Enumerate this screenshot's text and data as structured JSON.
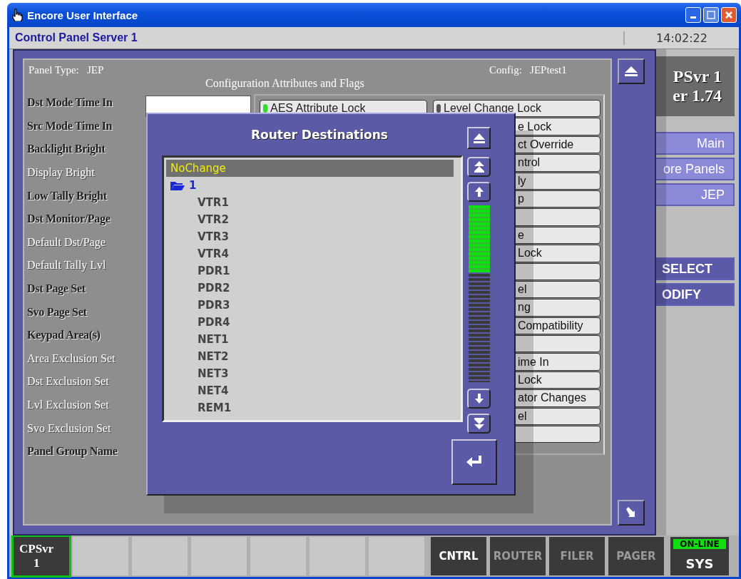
{
  "window": {
    "title": "Encore User Interface"
  },
  "header": {
    "title": "Control Panel Server 1",
    "clock": "14:02:22"
  },
  "logo": {
    "name": "PSvr 1",
    "version": "er 1.74"
  },
  "nav_buttons": [
    {
      "label": "Main"
    },
    {
      "label": "ore Panels"
    },
    {
      "label": "JEP"
    }
  ],
  "action_buttons": [
    {
      "label": "SELECT"
    },
    {
      "label": "ODIFY"
    }
  ],
  "config_dialog": {
    "panel_type_label": "Panel Type:",
    "panel_type": "JEP",
    "title": "Configuration Attributes and Flags",
    "config_label": "Config:",
    "config": "JEPtest1",
    "fields": [
      {
        "label": "Dst Mode Time In",
        "kind": "embossed"
      },
      {
        "label": "Src Mode Time In",
        "kind": "embossed"
      },
      {
        "label": "Backlight Bright",
        "kind": "embossed"
      },
      {
        "label": "Display Bright",
        "kind": "plain"
      },
      {
        "label": "Low Tally Bright",
        "kind": "embossed"
      },
      {
        "label": "Dst Monitor/Page",
        "kind": "embossed"
      },
      {
        "label": "Default Dst/Page",
        "kind": "plain"
      },
      {
        "label": "Default Tally Lvl",
        "kind": "plain"
      },
      {
        "label": "Dst Page Set",
        "kind": "embossed"
      },
      {
        "label": "Svo Page Set",
        "kind": "embossed"
      },
      {
        "label": "Keypad Area(s)",
        "kind": "embossed"
      },
      {
        "label": "Area Exclusion Set",
        "kind": "plain"
      },
      {
        "label": "Dst Exclusion Set",
        "kind": "plain"
      },
      {
        "label": "Lvl Exclusion Set",
        "kind": "plain"
      },
      {
        "label": "Svo Exclusion Set",
        "kind": "plain"
      },
      {
        "label": "Panel Group Name",
        "kind": "embossed"
      }
    ],
    "attribute_flags": [
      {
        "label": "AES Attribute Lock",
        "on": true
      },
      {
        "label": "Level Change Lock",
        "on": false
      }
    ],
    "partial_flags": [
      {
        "kind": "text",
        "text": "e Lock"
      },
      {
        "kind": "text",
        "text": "ct Override"
      },
      {
        "kind": "text",
        "text": "ntrol"
      },
      {
        "kind": "text",
        "text": "ly"
      },
      {
        "kind": "text",
        "text": "p"
      },
      {
        "kind": "blank"
      },
      {
        "kind": "text",
        "text": "e"
      },
      {
        "kind": "text",
        "text": "Lock"
      },
      {
        "kind": "blank"
      },
      {
        "kind": "text",
        "text": "el"
      },
      {
        "kind": "text",
        "text": "ng"
      },
      {
        "kind": "text",
        "text": "Compatibility"
      },
      {
        "kind": "blank"
      },
      {
        "kind": "text",
        "text": "ime In"
      },
      {
        "kind": "text",
        "text": "Lock"
      },
      {
        "kind": "text",
        "text": "ator Changes"
      },
      {
        "kind": "text",
        "text": "el"
      },
      {
        "kind": "blank"
      }
    ]
  },
  "router_dialog": {
    "title": "Router Destinations",
    "items": [
      {
        "label": "NoChange",
        "kind": "entry",
        "selected": true
      },
      {
        "label": "1",
        "kind": "folder",
        "selected": false,
        "expanded": true,
        "children": [
          {
            "label": "VTR1",
            "kind": "entry",
            "selected": false
          },
          {
            "label": "VTR2",
            "kind": "entry",
            "selected": false
          },
          {
            "label": "VTR3",
            "kind": "entry",
            "selected": false
          },
          {
            "label": "VTR4",
            "kind": "entry",
            "selected": false
          },
          {
            "label": "PDR1",
            "kind": "entry",
            "selected": false
          },
          {
            "label": "PDR2",
            "kind": "entry",
            "selected": false
          },
          {
            "label": "PDR3",
            "kind": "entry",
            "selected": false
          },
          {
            "label": "PDR4",
            "kind": "entry",
            "selected": false
          },
          {
            "label": "NET1",
            "kind": "entry",
            "selected": false
          },
          {
            "label": "NET2",
            "kind": "entry",
            "selected": false
          },
          {
            "label": "NET3",
            "kind": "entry",
            "selected": false
          },
          {
            "label": "NET4",
            "kind": "entry",
            "selected": false
          },
          {
            "label": "REM1",
            "kind": "entry",
            "selected": false
          }
        ]
      }
    ]
  },
  "bottom_tabs": [
    {
      "label": "CPSvr",
      "sublabel": "1",
      "selected": true
    },
    {
      "label": "CNTRL",
      "selected": false
    },
    {
      "label": "ROUTER",
      "selected": false
    },
    {
      "label": "FILER",
      "selected": false
    },
    {
      "label": "PAGER",
      "selected": false
    }
  ],
  "status": {
    "indicator": "ON-LINE",
    "label": "SYS"
  }
}
